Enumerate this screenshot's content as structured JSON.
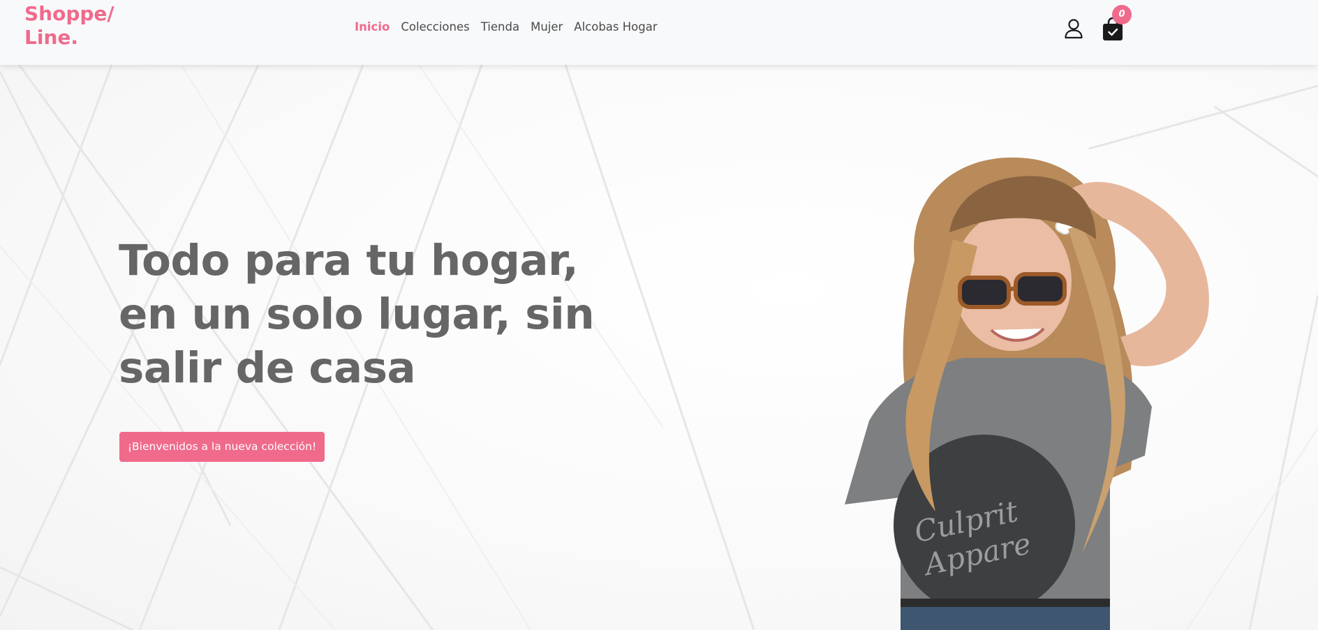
{
  "brand": {
    "line1": "Shoppe/",
    "line2": "Line.",
    "color": "#f06a8b"
  },
  "nav": {
    "items": [
      {
        "label": "Inicio",
        "active": true
      },
      {
        "label": "Colecciones",
        "active": false
      },
      {
        "label": "Tienda",
        "active": false
      },
      {
        "label": "Mujer",
        "active": false
      },
      {
        "label": "Alcobas Hogar",
        "active": false
      }
    ]
  },
  "header_icons": {
    "user": "user-icon",
    "cart": "shopping-bag-check-icon",
    "cart_count": "0"
  },
  "hero": {
    "title": "Todo para tu hogar, en un solo lugar, sin salir de casa",
    "cta_label": "¡Bienvenidos a la nueva colección!",
    "image": "woman-sunglasses-gray-tshirt",
    "tshirt_text": "Culprit Apparel"
  },
  "colors": {
    "accent": "#f06a8b",
    "heading": "#666666",
    "nav_text": "#4a4a4a",
    "header_bg": "#f8f9fb"
  }
}
